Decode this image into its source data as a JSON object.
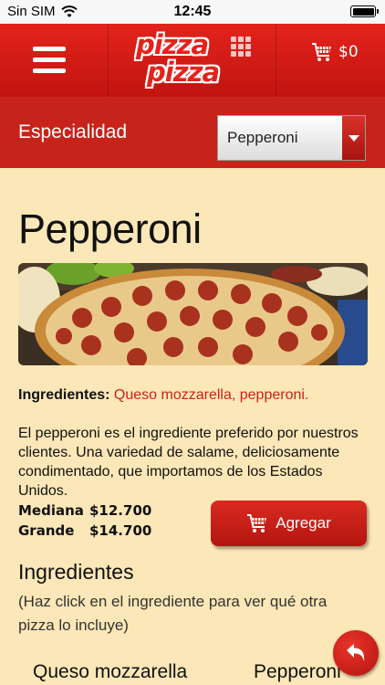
{
  "status_bar": {
    "carrier": "Sin SIM",
    "time": "12:45",
    "icons": [
      "wifi-icon",
      "battery-icon"
    ]
  },
  "header": {
    "menu_icon": "hamburger-menu-icon",
    "logo_line_1": "pizza",
    "logo_line_2": "pizza",
    "cart_icon": "cart-icon",
    "cart_total": "$0"
  },
  "specialty": {
    "label": "Especialidad",
    "selected": "Pepperoni"
  },
  "product": {
    "title": "Pepperoni",
    "ingredients_label": "Ingredientes:",
    "ingredients_value": "Queso mozzarella, pepperoni.",
    "description": "El pepperoni es el ingrediente preferido por nuestros clientes. Una variedad de salame, deliciosamente condimentado, que importamos de los Estados Unidos.",
    "prices": [
      {
        "size": "Mediana",
        "price": "$12.700"
      },
      {
        "size": "Grande",
        "price": "$14.700"
      }
    ],
    "add_button": "Agregar"
  },
  "ingredients_section": {
    "title": "Ingredientes",
    "hint": "(Haz click en el ingrediente para ver qué otra pizza lo incluye)",
    "items": [
      "Queso mozzarella",
      "Pepperoni"
    ]
  },
  "colors": {
    "brand_red": "#c8231a",
    "background": "#fbe7b7",
    "accent_text": "#c8231a"
  }
}
